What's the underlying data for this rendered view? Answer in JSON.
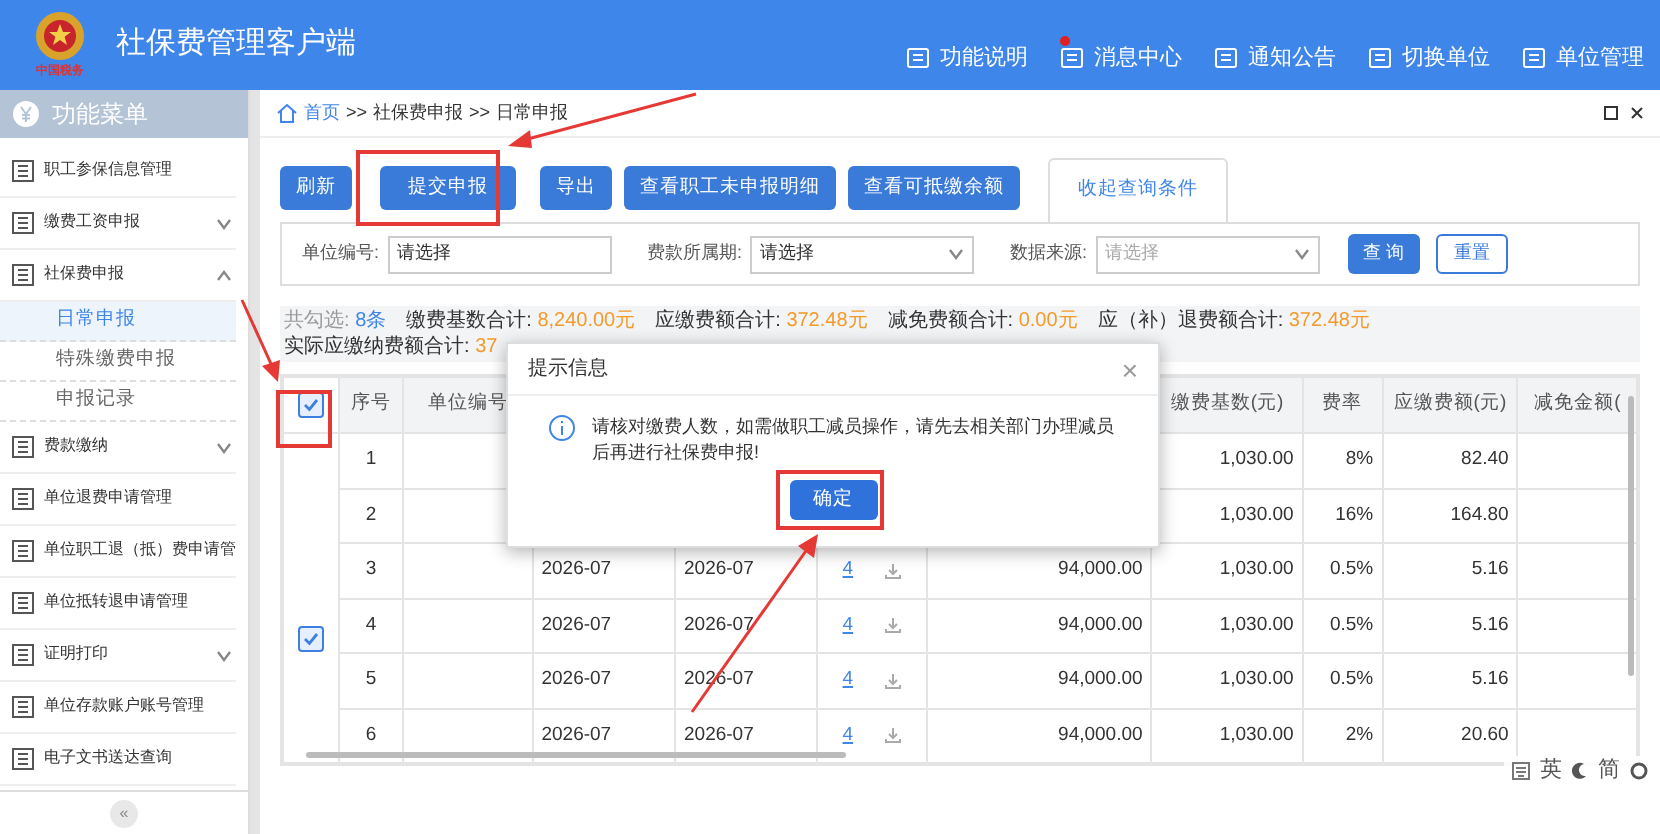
{
  "header": {
    "title": "社保费管理客户端",
    "logo_caption": "中国税务",
    "nav": [
      {
        "label": "功能说明",
        "unread": false
      },
      {
        "label": "消息中心",
        "unread": true
      },
      {
        "label": "通知公告",
        "unread": false
      },
      {
        "label": "切换单位",
        "unread": false
      },
      {
        "label": "单位管理",
        "unread": false
      }
    ]
  },
  "sidebar": {
    "title": "功能菜单",
    "items": [
      {
        "kind": "link",
        "label": "职工参保信息管理"
      },
      {
        "kind": "group",
        "label": "缴费工资申报",
        "expanded": false
      },
      {
        "kind": "group",
        "label": "社保费申报",
        "expanded": true,
        "children": [
          {
            "label": "日常申报",
            "selected": true
          },
          {
            "label": "特殊缴费申报",
            "selected": false
          },
          {
            "label": "申报记录",
            "selected": false
          }
        ]
      },
      {
        "kind": "group",
        "label": "费款缴纳",
        "expanded": false
      },
      {
        "kind": "link",
        "label": "单位退费申请管理"
      },
      {
        "kind": "link",
        "label": "单位职工退（抵）费申请管"
      },
      {
        "kind": "link",
        "label": "单位抵转退申请管理"
      },
      {
        "kind": "group",
        "label": "证明打印",
        "expanded": false
      },
      {
        "kind": "link",
        "label": "单位存款账户账号管理"
      },
      {
        "kind": "link",
        "label": "电子文书送达查询"
      }
    ],
    "collapse": "«"
  },
  "breadcrumb": [
    "首页",
    "社保费申报",
    "日常申报"
  ],
  "breadcrumb_separator": ">>",
  "toolbar": {
    "buttons": [
      "刷新",
      "提交申报",
      "导出",
      "查看职工未申报明细",
      "查看可抵缴余额"
    ],
    "toggle": "收起查询条件"
  },
  "filters": [
    {
      "label": "单位编号:",
      "kind": "input",
      "value": "请选择"
    },
    {
      "label": "费款所属期:",
      "kind": "select",
      "value": "请选择"
    },
    {
      "label": "数据来源:",
      "kind": "select",
      "placeholder": "请选择"
    }
  ],
  "filter_buttons": {
    "search": "查 询",
    "reset": "重置"
  },
  "summary": [
    {
      "label": "共勾选:",
      "value": "8条"
    },
    {
      "label": "缴费基数合计:",
      "value": "8,240.00元"
    },
    {
      "label": "应缴费额合计:",
      "value": "372.48元"
    },
    {
      "label": "减免费额合计:",
      "value": "0.00元"
    },
    {
      "label": "应（补）退费额合计:",
      "value": "372.48元"
    },
    {
      "label": "实际应缴纳费额合计:",
      "value": "37"
    }
  ],
  "table": {
    "header_checked": true,
    "rows_checked": true,
    "columns": [
      {
        "label": "序号"
      },
      {
        "label": "单位编号"
      },
      {},
      {},
      {},
      {},
      {
        "label": "缴费基数(元)"
      },
      {
        "label": "费率"
      },
      {
        "label": "应缴费额(元)"
      },
      {
        "label": "减免金额("
      }
    ],
    "rows": [
      {
        "cells": [
          "1",
          "",
          null,
          null,
          null,
          null,
          "1,030.00",
          "8%",
          "82.40",
          ""
        ]
      },
      {
        "cells": [
          "2",
          "",
          null,
          null,
          null,
          null,
          "1,030.00",
          "16%",
          "164.80",
          ""
        ]
      },
      {
        "cells": [
          "3",
          "",
          "2026-07",
          "2026-07",
          "4",
          "94,000.00",
          "1,030.00",
          "0.5%",
          "5.16",
          ""
        ]
      },
      {
        "cells": [
          "4",
          "",
          "2026-07",
          "2026-07",
          "4",
          "94,000.00",
          "1,030.00",
          "0.5%",
          "5.16",
          ""
        ]
      },
      {
        "cells": [
          "5",
          "",
          "2026-07",
          "2026-07",
          "4",
          "94,000.00",
          "1,030.00",
          "0.5%",
          "5.16",
          ""
        ]
      },
      {
        "cells": [
          "6",
          "",
          "2026-07",
          "2026-07",
          "4",
          "94,000.00",
          "1,030.00",
          "2%",
          "20.60",
          ""
        ]
      }
    ]
  },
  "dialog": {
    "title": "提示信息",
    "close": "×",
    "message": "请核对缴费人数，如需做职工减员操作，请先去相关部门办理减员后再进行社保费申报!",
    "button": "确定"
  },
  "ime_toolbar": {
    "language": "英",
    "script": "简"
  }
}
